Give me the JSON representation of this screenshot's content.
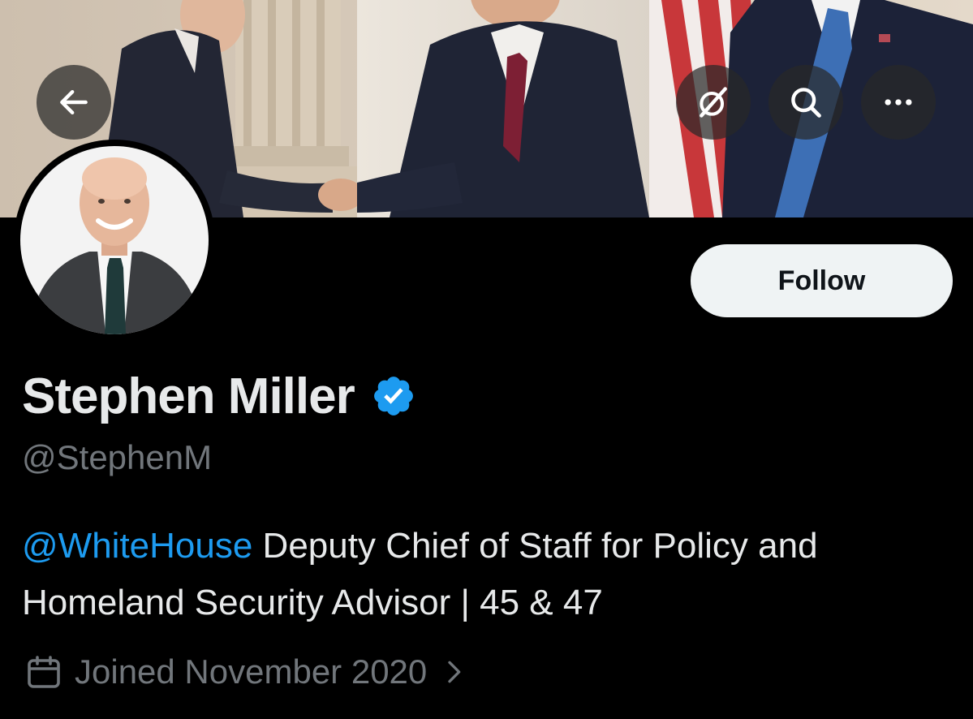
{
  "header": {
    "back_icon": "arrow-left-icon",
    "grok_icon": "grok-icon",
    "search_icon": "search-icon",
    "more_icon": "more-horizontal-icon"
  },
  "profile": {
    "display_name": "Stephen Miller",
    "verified_badge": "verified-badge-icon",
    "handle": "@StephenM",
    "follow_label": "Follow",
    "bio_mention": "@WhiteHouse",
    "bio_text": " Deputy Chief of Staff for Policy and Homeland Security Advisor | 45 & 47",
    "joined_text": "Joined November 2020"
  },
  "colors": {
    "background": "#000000",
    "accent": "#1d9bf0",
    "text_primary": "#e7e9ea",
    "text_secondary": "#71767b",
    "follow_bg": "#eff3f4"
  }
}
